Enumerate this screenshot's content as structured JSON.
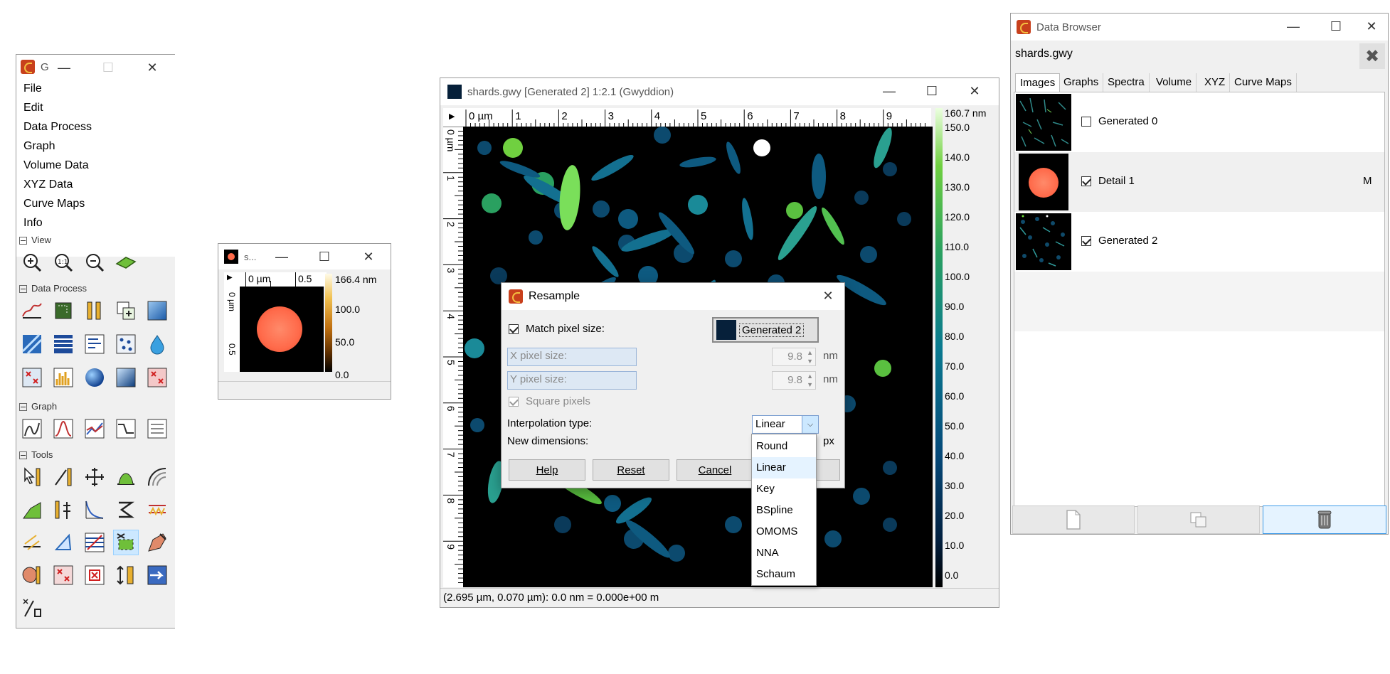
{
  "toolbox": {
    "title": "G",
    "menu": [
      {
        "label": "File"
      },
      {
        "label": "Edit"
      },
      {
        "label": "Data Process"
      },
      {
        "label": "Graph"
      },
      {
        "label": "Volume Data"
      },
      {
        "label": "XYZ Data"
      },
      {
        "label": "Curve Maps"
      },
      {
        "label": "Info"
      }
    ],
    "sections": {
      "view": "View",
      "data_process": "Data Process",
      "graph": "Graph",
      "tools": "Tools"
    }
  },
  "small_window": {
    "title": "s...",
    "ruler_labels": [
      "0 µm",
      "0.5"
    ],
    "vruler_labels": [
      "0 µm",
      "0.5"
    ],
    "colorbar_labels": [
      "166.4 nm",
      "100.0",
      "50.0",
      "0.0"
    ]
  },
  "main_window": {
    "title": "shards.gwy [Generated 2] 1:2.1 (Gwyddion)",
    "ruler_labels": [
      "0 µm",
      "1",
      "2",
      "3",
      "4",
      "5",
      "6",
      "7",
      "8",
      "9"
    ],
    "vruler_labels": [
      "0 µm",
      "1",
      "2",
      "3",
      "4",
      "5",
      "6",
      "7",
      "8",
      "9"
    ],
    "colorbar_labels": [
      "160.7 nm",
      "150.0",
      "140.0",
      "130.0",
      "120.0",
      "110.0",
      "100.0",
      "90.0",
      "80.0",
      "70.0",
      "60.0",
      "50.0",
      "40.0",
      "30.0",
      "20.0",
      "10.0",
      "0.0"
    ],
    "status": "(2.695 µm, 0.070 µm): 0.0 nm = 0.000e+00 m"
  },
  "resample_dialog": {
    "title": "Resample",
    "match_pixel_size": "Match pixel size:",
    "match_source": "Generated 2",
    "x_pixel_label": "X pixel size:",
    "y_pixel_label": "Y pixel size:",
    "x_value": "9.8",
    "y_value": "9.8",
    "unit_nm": "nm",
    "square_pixels": "Square pixels",
    "interp_label": "Interpolation type:",
    "interp_value": "Linear",
    "new_dims_label": "New dimensions:",
    "unit_px": "px",
    "help": "Help",
    "reset": "Reset",
    "cancel": "Cancel",
    "options": [
      "Round",
      "Linear",
      "Key",
      "BSpline",
      "OMOMS",
      "NNA",
      "Schaum"
    ]
  },
  "data_browser": {
    "title": "Data Browser",
    "file": "shards.gwy",
    "tabs": [
      "Images",
      "Graphs",
      "Spectra",
      "Volume",
      "XYZ",
      "Curve Maps"
    ],
    "items": [
      {
        "name": "Generated 0",
        "checked": false,
        "flag": ""
      },
      {
        "name": "Detail 1",
        "checked": true,
        "flag": "M"
      },
      {
        "name": "Generated 2",
        "checked": true,
        "flag": ""
      }
    ]
  },
  "colors": {
    "accent_select": "#cce8ff",
    "image_bg": "#000000",
    "spot": "#ff6a4a"
  }
}
